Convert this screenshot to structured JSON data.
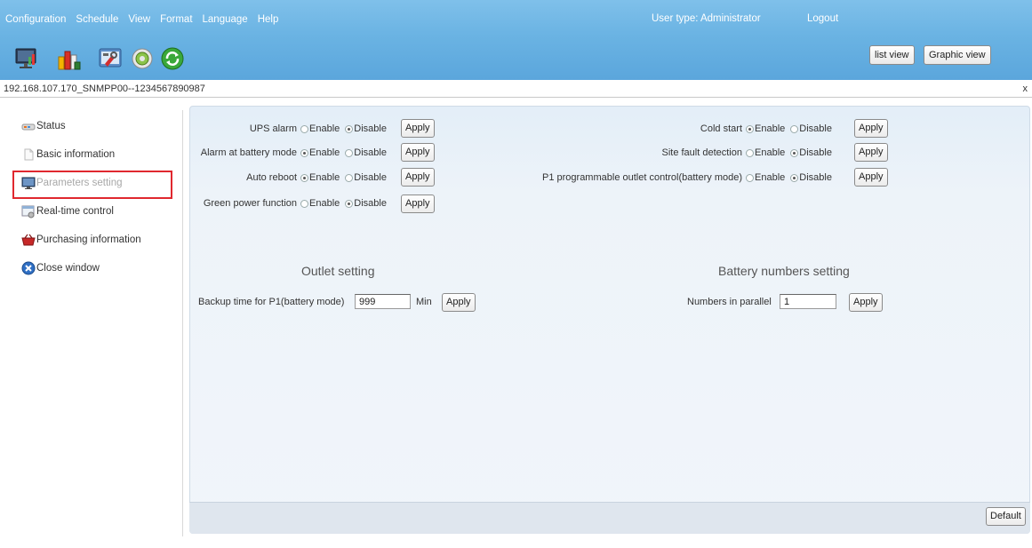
{
  "menu": [
    "Configuration",
    "Schedule",
    "View",
    "Format",
    "Language",
    "Help"
  ],
  "header": {
    "user_type": "User type:  Administrator",
    "logout": "Logout",
    "list_view": "list view",
    "graphic_view": "Graphic view"
  },
  "toolbar_icons": [
    "monitor-icon",
    "chart-icon",
    "tools-icon",
    "settings-icon",
    "refresh-icon"
  ],
  "address": {
    "text": "192.168.107.170_SNMPP00--1234567890987",
    "close": "x"
  },
  "sidebar": {
    "items": [
      {
        "label": "Status",
        "icon": "status-icon"
      },
      {
        "label": "Basic information",
        "icon": "document-icon"
      },
      {
        "label": "Parameters setting",
        "icon": "monitor-icon"
      },
      {
        "label": "Real-time control",
        "icon": "control-icon"
      },
      {
        "label": "Purchasing information",
        "icon": "basket-icon"
      },
      {
        "label": "Close window",
        "icon": "close-circle-icon"
      }
    ],
    "selected_index": 2
  },
  "radio_labels": {
    "enable": "Enable",
    "disable": "Disable"
  },
  "apply_label": "Apply",
  "settings_left": [
    {
      "label": "UPS alarm",
      "value": "Disable"
    },
    {
      "label": "Alarm at battery mode",
      "value": "Enable"
    },
    {
      "label": "Auto reboot",
      "value": "Enable"
    },
    {
      "label": "Green power function",
      "value": "Disable"
    }
  ],
  "settings_right": [
    {
      "label": "Cold start",
      "value": "Enable"
    },
    {
      "label": "Site fault detection",
      "value": "Disable"
    },
    {
      "label": "P1 programmable outlet control(battery mode)",
      "value": "Disable"
    }
  ],
  "outlet": {
    "title": "Outlet setting",
    "backup_label": "Backup time for P1(battery mode)",
    "backup_value": "999",
    "unit": "Min"
  },
  "battery": {
    "title": "Battery numbers setting",
    "parallel_label": "Numbers in parallel",
    "parallel_value": "1"
  },
  "footer": {
    "default_label": "Default"
  },
  "colors": {
    "header_blue": "#6ab3e3",
    "selection_red": "#e0282f",
    "panel_bg": "#edf3f9"
  }
}
